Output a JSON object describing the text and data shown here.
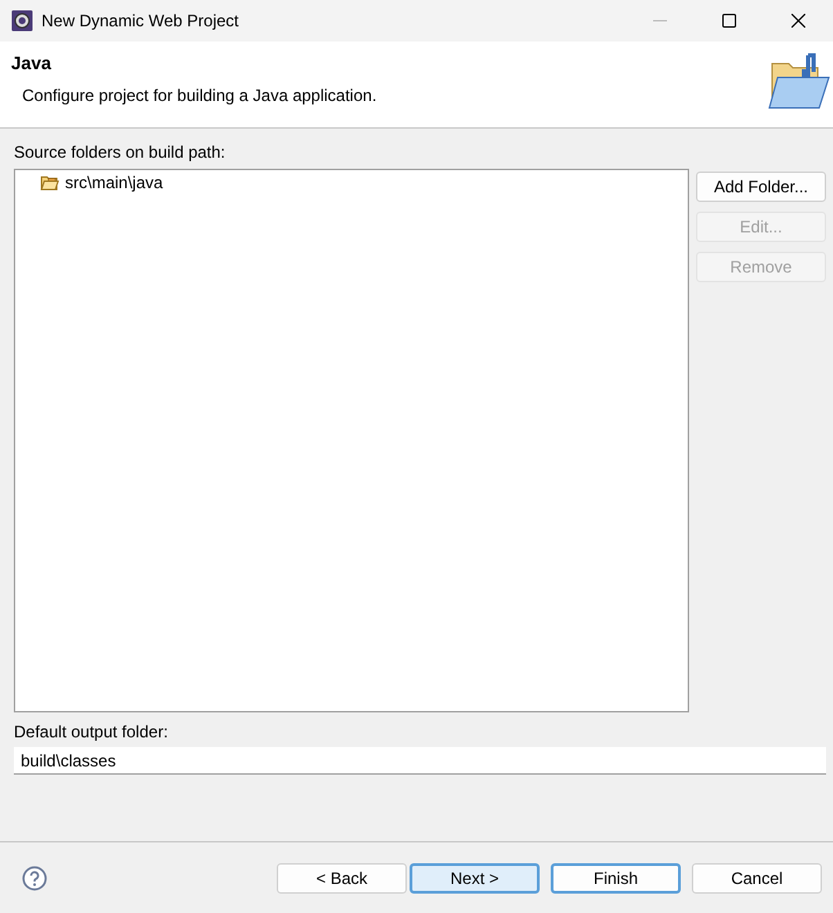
{
  "window": {
    "title": "New Dynamic Web Project"
  },
  "header": {
    "title": "Java",
    "description": "Configure project for building a Java application."
  },
  "source_folders": {
    "label": "Source folders on build path:",
    "items": [
      {
        "label": "src\\main\\java",
        "selected": false
      }
    ]
  },
  "side_buttons": [
    {
      "label": "Add Folder...",
      "disabled": false
    },
    {
      "label": "Edit...",
      "disabled": true
    },
    {
      "label": "Remove",
      "disabled": true
    }
  ],
  "output_folder": {
    "label": "Default output folder:",
    "value": "build\\classes"
  },
  "footer_buttons": [
    {
      "label": "< Back",
      "kind": "normal"
    },
    {
      "label": "Next >",
      "kind": "default"
    },
    {
      "label": "Finish",
      "kind": "focused"
    },
    {
      "label": "Cancel",
      "kind": "normal"
    }
  ]
}
